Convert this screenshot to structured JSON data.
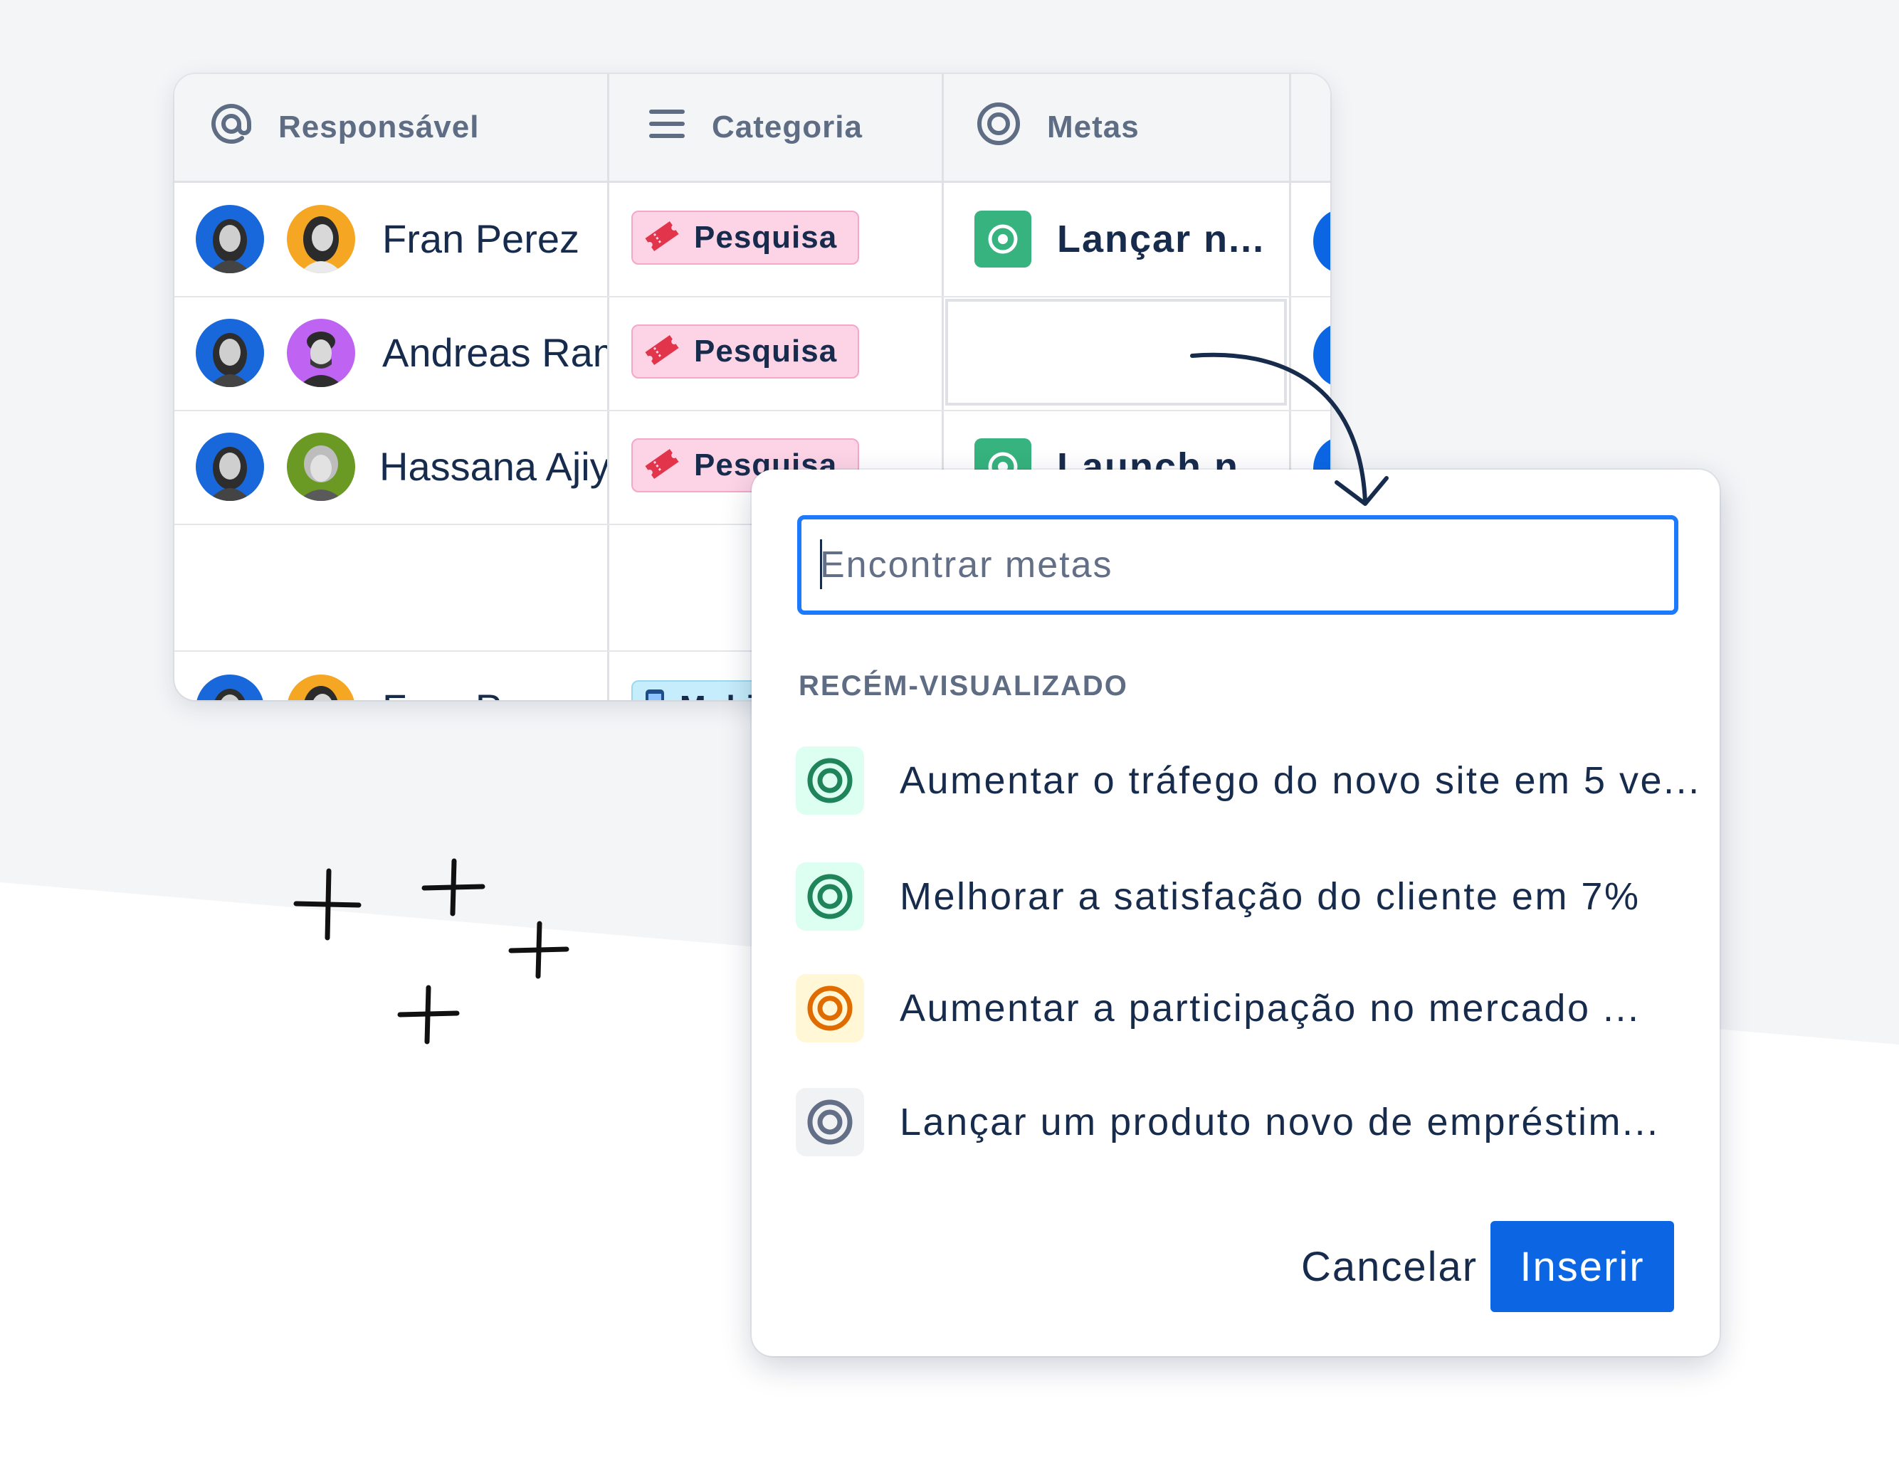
{
  "table": {
    "columns": [
      {
        "label": "Responsável",
        "icon": "at-sign-icon"
      },
      {
        "label": "Categoria",
        "icon": "list-lines-icon"
      },
      {
        "label": "Metas",
        "icon": "target-icon"
      }
    ],
    "rows": [
      {
        "name": "Fran Perez",
        "category": "Pesquisa",
        "goal": "Lançar n..."
      },
      {
        "name": "Andreas Ramos",
        "category": "Pesquisa",
        "goal": ""
      },
      {
        "name": "Hassana Ajiya",
        "category": "Pesquisa",
        "goal": "Launch n..."
      },
      {
        "name": "Fran Perez",
        "category": "Mobile",
        "goal": ""
      }
    ]
  },
  "goal_picker": {
    "search_placeholder": "Encontrar metas",
    "section_label": "RECÉM-VISUALIZADO",
    "goals": [
      {
        "label": "Aumentar o tráfego do novo site em 5 ve...",
        "color": "#1f845a",
        "bg": "#dcfff1"
      },
      {
        "label": "Melhorar a satisfação do cliente em 7%",
        "color": "#1f845a",
        "bg": "#dcfff1"
      },
      {
        "label": "Aumentar a participação no mercado ...",
        "color": "#e06c00",
        "bg": "#fff7d6"
      },
      {
        "label": "Lançar um produto novo de empréstim...",
        "color": "#626f86",
        "bg": "#f1f2f4"
      }
    ],
    "cancel_label": "Cancelar",
    "insert_label": "Inserir"
  },
  "colors": {
    "primary": "#0c66e4",
    "focus_border": "#1d7afc",
    "tag_bg": "#fcd4e6",
    "goal_green": "#36b37e",
    "page_bg_gray": "#f4f5f7"
  }
}
